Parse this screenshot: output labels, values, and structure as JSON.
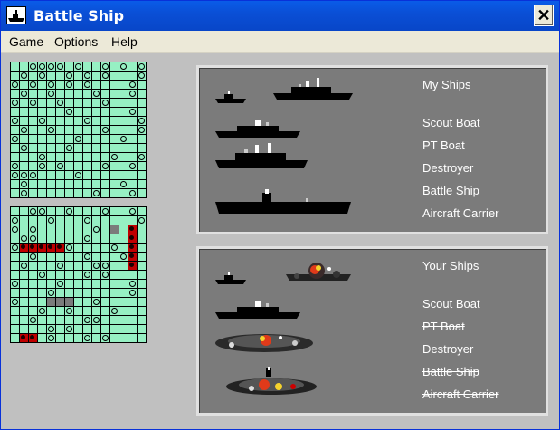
{
  "window": {
    "title": "Battle Ship",
    "close_glyph": "✕"
  },
  "menu": [
    "Game",
    "Options",
    "Help"
  ],
  "grids": {
    "size": 15,
    "top": {
      "misses": [
        [
          0,
          2
        ],
        [
          0,
          3
        ],
        [
          0,
          4
        ],
        [
          0,
          5
        ],
        [
          0,
          7
        ],
        [
          0,
          10
        ],
        [
          0,
          12
        ],
        [
          0,
          14
        ],
        [
          1,
          1
        ],
        [
          1,
          3
        ],
        [
          1,
          6
        ],
        [
          1,
          8
        ],
        [
          1,
          10
        ],
        [
          1,
          14
        ],
        [
          2,
          0
        ],
        [
          2,
          2
        ],
        [
          2,
          4
        ],
        [
          2,
          6
        ],
        [
          2,
          8
        ],
        [
          2,
          13
        ],
        [
          3,
          1
        ],
        [
          3,
          4
        ],
        [
          3,
          9
        ],
        [
          3,
          13
        ],
        [
          4,
          0
        ],
        [
          4,
          2
        ],
        [
          4,
          5
        ],
        [
          4,
          10
        ],
        [
          5,
          6
        ],
        [
          5,
          13
        ],
        [
          6,
          0
        ],
        [
          6,
          3
        ],
        [
          6,
          8
        ],
        [
          6,
          14
        ],
        [
          7,
          1
        ],
        [
          7,
          4
        ],
        [
          7,
          10
        ],
        [
          7,
          14
        ],
        [
          8,
          0
        ],
        [
          8,
          7
        ],
        [
          8,
          12
        ],
        [
          9,
          1
        ],
        [
          9,
          6
        ],
        [
          10,
          3
        ],
        [
          10,
          11
        ],
        [
          10,
          14
        ],
        [
          11,
          0
        ],
        [
          11,
          3
        ],
        [
          11,
          5
        ],
        [
          11,
          10
        ],
        [
          11,
          13
        ],
        [
          12,
          0
        ],
        [
          12,
          1
        ],
        [
          12,
          2
        ],
        [
          12,
          7
        ],
        [
          13,
          1
        ],
        [
          13,
          12
        ],
        [
          14,
          1
        ],
        [
          14,
          9
        ],
        [
          14,
          13
        ]
      ],
      "hits": [],
      "grays": []
    },
    "bottom": {
      "misses": [
        [
          0,
          2
        ],
        [
          0,
          3
        ],
        [
          0,
          6
        ],
        [
          0,
          10
        ],
        [
          0,
          13
        ],
        [
          1,
          0
        ],
        [
          1,
          4
        ],
        [
          1,
          8
        ],
        [
          1,
          14
        ],
        [
          2,
          0
        ],
        [
          2,
          2
        ],
        [
          2,
          9
        ],
        [
          3,
          1
        ],
        [
          3,
          2
        ],
        [
          3,
          8
        ],
        [
          3,
          13
        ],
        [
          4,
          0
        ],
        [
          4,
          3
        ],
        [
          4,
          6
        ],
        [
          4,
          11
        ],
        [
          5,
          2
        ],
        [
          5,
          8
        ],
        [
          5,
          12
        ],
        [
          6,
          1
        ],
        [
          6,
          5
        ],
        [
          6,
          9
        ],
        [
          6,
          10
        ],
        [
          7,
          3
        ],
        [
          7,
          8
        ],
        [
          7,
          10
        ],
        [
          8,
          0
        ],
        [
          8,
          5
        ],
        [
          8,
          13
        ],
        [
          9,
          4
        ],
        [
          9,
          13
        ],
        [
          10,
          0
        ],
        [
          10,
          9
        ],
        [
          11,
          3
        ],
        [
          11,
          6
        ],
        [
          11,
          11
        ],
        [
          12,
          2
        ],
        [
          12,
          8
        ],
        [
          12,
          9
        ],
        [
          13,
          4
        ],
        [
          13,
          6
        ],
        [
          14,
          4
        ],
        [
          14,
          8
        ],
        [
          14,
          10
        ]
      ],
      "hits": [
        [
          4,
          1
        ],
        [
          4,
          2
        ],
        [
          4,
          3
        ],
        [
          4,
          4
        ],
        [
          4,
          5
        ],
        [
          2,
          13
        ],
        [
          3,
          13
        ],
        [
          4,
          13
        ],
        [
          5,
          13
        ],
        [
          6,
          13
        ],
        [
          14,
          1
        ],
        [
          14,
          2
        ]
      ],
      "grays": [
        [
          2,
          11
        ],
        [
          10,
          4
        ],
        [
          10,
          5
        ],
        [
          10,
          6
        ]
      ]
    }
  },
  "my_ships": {
    "title": "My Ships",
    "ships": [
      {
        "name": "Scout Boat",
        "status": "afloat"
      },
      {
        "name": "PT Boat",
        "status": "afloat"
      },
      {
        "name": "Destroyer",
        "status": "afloat"
      },
      {
        "name": "Battle Ship",
        "status": "afloat"
      },
      {
        "name": "Aircraft Carrier",
        "status": "afloat"
      }
    ]
  },
  "your_ships": {
    "title": "Your Ships",
    "ships": [
      {
        "name": "Scout Boat",
        "status": "afloat"
      },
      {
        "name": "PT Boat",
        "status": "sunk"
      },
      {
        "name": "Destroyer",
        "status": "afloat"
      },
      {
        "name": "Battle Ship",
        "status": "sunk"
      },
      {
        "name": "Aircraft Carrier",
        "status": "sunk"
      }
    ]
  },
  "colors": {
    "water": "#96f0c3",
    "hit": "#c00000",
    "panel": "#7b7b7b",
    "title_bar": "#0a5ce8"
  }
}
